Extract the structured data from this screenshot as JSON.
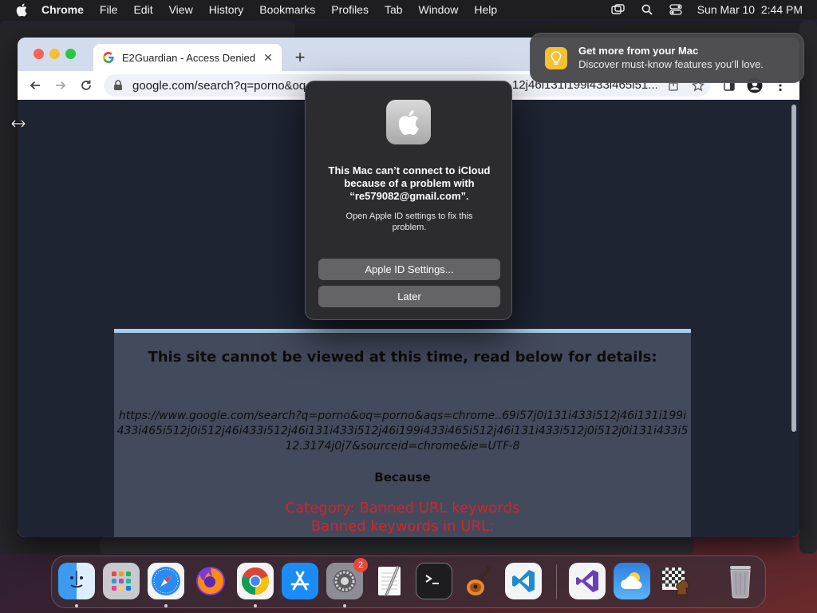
{
  "menubar": {
    "app_name": "Chrome",
    "menus": [
      "File",
      "Edit",
      "View",
      "History",
      "Bookmarks",
      "Profiles",
      "Tab",
      "Window",
      "Help"
    ],
    "datetime": "Sun Mar 10  2:44 PM"
  },
  "browser": {
    "tab_title": "E2Guardian - Access Denied",
    "url": "google.com/search?q=porno&oq",
    "url_tail": "12j46i131i199i433i465i51..."
  },
  "page": {
    "headline": "This site cannot be viewed at this time, read below for details:",
    "blocked_url": "https://www.google.com/search?q=porno&oq=porno&aqs=chrome..69i57j0i131i433i512j46i131i199i433i465i512j0i512j46i433i512j46i131i433i512j46i199i433i465i512j46i131i433i512j0i512j0i131i433i512.3174j0j7&sourceid=chrome&ie=UTF-8",
    "because": "Because",
    "category": "Category: Banned URL keywords",
    "reason": "Banned keywords in URL:"
  },
  "dialog": {
    "title": "This Mac can’t connect to iCloud because of a problem with “re579082@gmail.com”.",
    "message": "Open Apple ID settings to fix this problem.",
    "primary_button": "Apple ID Settings...",
    "secondary_button": "Later"
  },
  "notification": {
    "title": "Get more from your Mac",
    "body": "Discover must-know features you’ll love."
  },
  "dock": {
    "items": [
      "Finder",
      "Launchpad",
      "Safari",
      "Firefox",
      "Chrome",
      "App Store",
      "System Settings",
      "TextEdit",
      "Terminal",
      "GarageBand",
      "VS Code",
      "Visual Studio",
      "Weather",
      "Chess",
      "Trash"
    ],
    "settings_badge": "2"
  },
  "colors": {
    "category_red": "#d4242b",
    "notice_bar": "#a7cdea",
    "page_background": "#1f2433"
  }
}
